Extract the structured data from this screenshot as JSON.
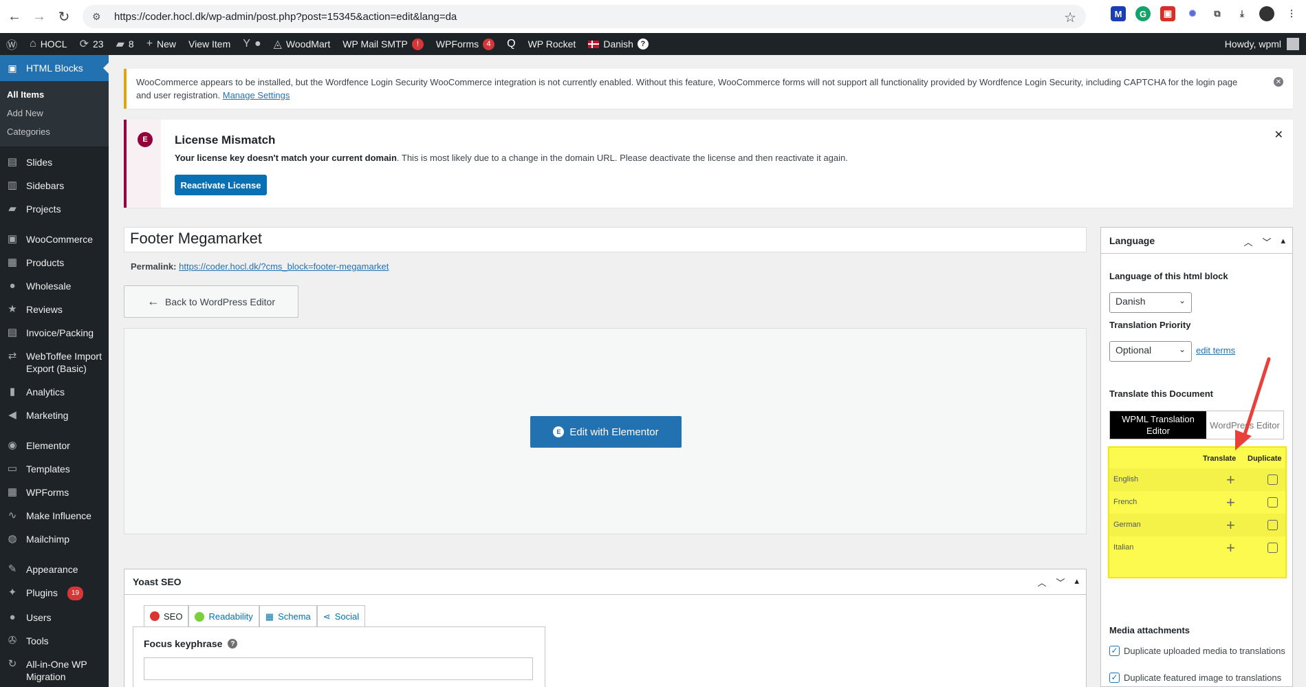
{
  "browser": {
    "url": "https://coder.hocl.dk/wp-admin/post.php?post=15345&action=edit&lang=da"
  },
  "adminbar": {
    "site": "HOCL",
    "updates": "23",
    "comments": "8",
    "new": "New",
    "view_item": "View Item",
    "woodmart": "WoodMart",
    "wp_mail_smtp": "WP Mail SMTP",
    "wp_mail_smtp_badge": "!",
    "wpforms": "WPForms",
    "wpforms_badge": "4",
    "wp_rocket": "WP Rocket",
    "language": "Danish",
    "howdy": "Howdy, wpml"
  },
  "sidebar": {
    "current": "HTML Blocks",
    "submenu": [
      "All Items",
      "Add New",
      "Categories"
    ],
    "items": [
      {
        "label": "Slides",
        "icon": "slides-icon",
        "glyph": "▤"
      },
      {
        "label": "Sidebars",
        "icon": "sidebars-icon",
        "glyph": "▥"
      },
      {
        "label": "Projects",
        "icon": "projects-icon",
        "glyph": "▰"
      },
      {
        "label": "WooCommerce",
        "icon": "woocommerce-icon",
        "glyph": "▣"
      },
      {
        "label": "Products",
        "icon": "products-icon",
        "glyph": "▦"
      },
      {
        "label": "Wholesale",
        "icon": "wholesale-icon",
        "glyph": "●"
      },
      {
        "label": "Reviews",
        "icon": "reviews-icon",
        "glyph": "★"
      },
      {
        "label": "Invoice/Packing",
        "icon": "invoice-icon",
        "glyph": "▤"
      },
      {
        "label": "WebToffee Import Export (Basic)",
        "icon": "import-export-icon",
        "glyph": "⇄"
      },
      {
        "label": "Analytics",
        "icon": "analytics-icon",
        "glyph": "▮"
      },
      {
        "label": "Marketing",
        "icon": "marketing-icon",
        "glyph": "◀"
      },
      {
        "label": "Elementor",
        "icon": "elementor-icon",
        "glyph": "◉"
      },
      {
        "label": "Templates",
        "icon": "templates-icon",
        "glyph": "▭"
      },
      {
        "label": "WPForms",
        "icon": "wpforms-icon",
        "glyph": "▦"
      },
      {
        "label": "Make Influence",
        "icon": "make-influence-icon",
        "glyph": "∿"
      },
      {
        "label": "Mailchimp",
        "icon": "mailchimp-icon",
        "glyph": "◍"
      },
      {
        "label": "Appearance",
        "icon": "appearance-icon",
        "glyph": "✎"
      },
      {
        "label": "Plugins",
        "icon": "plugins-icon",
        "glyph": "✦",
        "badge": "19"
      },
      {
        "label": "Users",
        "icon": "users-icon",
        "glyph": "●"
      },
      {
        "label": "Tools",
        "icon": "tools-icon",
        "glyph": "✇"
      },
      {
        "label": "All-in-One WP Migration",
        "icon": "migration-icon",
        "glyph": "↻"
      }
    ]
  },
  "notice_wordfence": {
    "text": "WooCommerce appears to be installed, but the Wordfence Login Security WooCommerce integration is not currently enabled. Without this feature, WooCommerce forms will not support all functionality provided by Wordfence Login Security, including CAPTCHA for the login page and user registration.",
    "link": "Manage Settings"
  },
  "notice_license": {
    "title": "License Mismatch",
    "bold": "Your license key doesn't match your current domain",
    "text": ". This is most likely due to a change in the domain URL. Please deactivate the license and then reactivate it again.",
    "button": "Reactivate License"
  },
  "post": {
    "title": "Footer Megamarket",
    "permalink_label": "Permalink:",
    "permalink_url": "https://coder.hocl.dk/?cms_block=footer-megamarket",
    "back_button": "Back to WordPress Editor",
    "edit_button": "Edit with Elementor"
  },
  "yoast": {
    "title": "Yoast SEO",
    "tabs": [
      "SEO",
      "Readability",
      "Schema",
      "Social"
    ],
    "focus_label": "Focus keyphrase",
    "focus_value": ""
  },
  "language_box": {
    "title": "Language",
    "lang_label": "Language of this html block",
    "lang_value": "Danish",
    "priority_label": "Translation Priority",
    "priority_value": "Optional",
    "edit_terms": "edit terms",
    "translate_label": "Translate this Document",
    "switch_on": "WPML Translation Editor",
    "switch_off": "WordPress Editor",
    "col_translate": "Translate",
    "col_duplicate": "Duplicate",
    "languages": [
      "English",
      "French",
      "German",
      "Italian"
    ],
    "media_label": "Media attachments",
    "dup_media": "Duplicate uploaded media to translations",
    "dup_featured": "Duplicate featured image to translations",
    "highlight_color": "#fcf94f",
    "arrow_color": "#e8413b"
  }
}
